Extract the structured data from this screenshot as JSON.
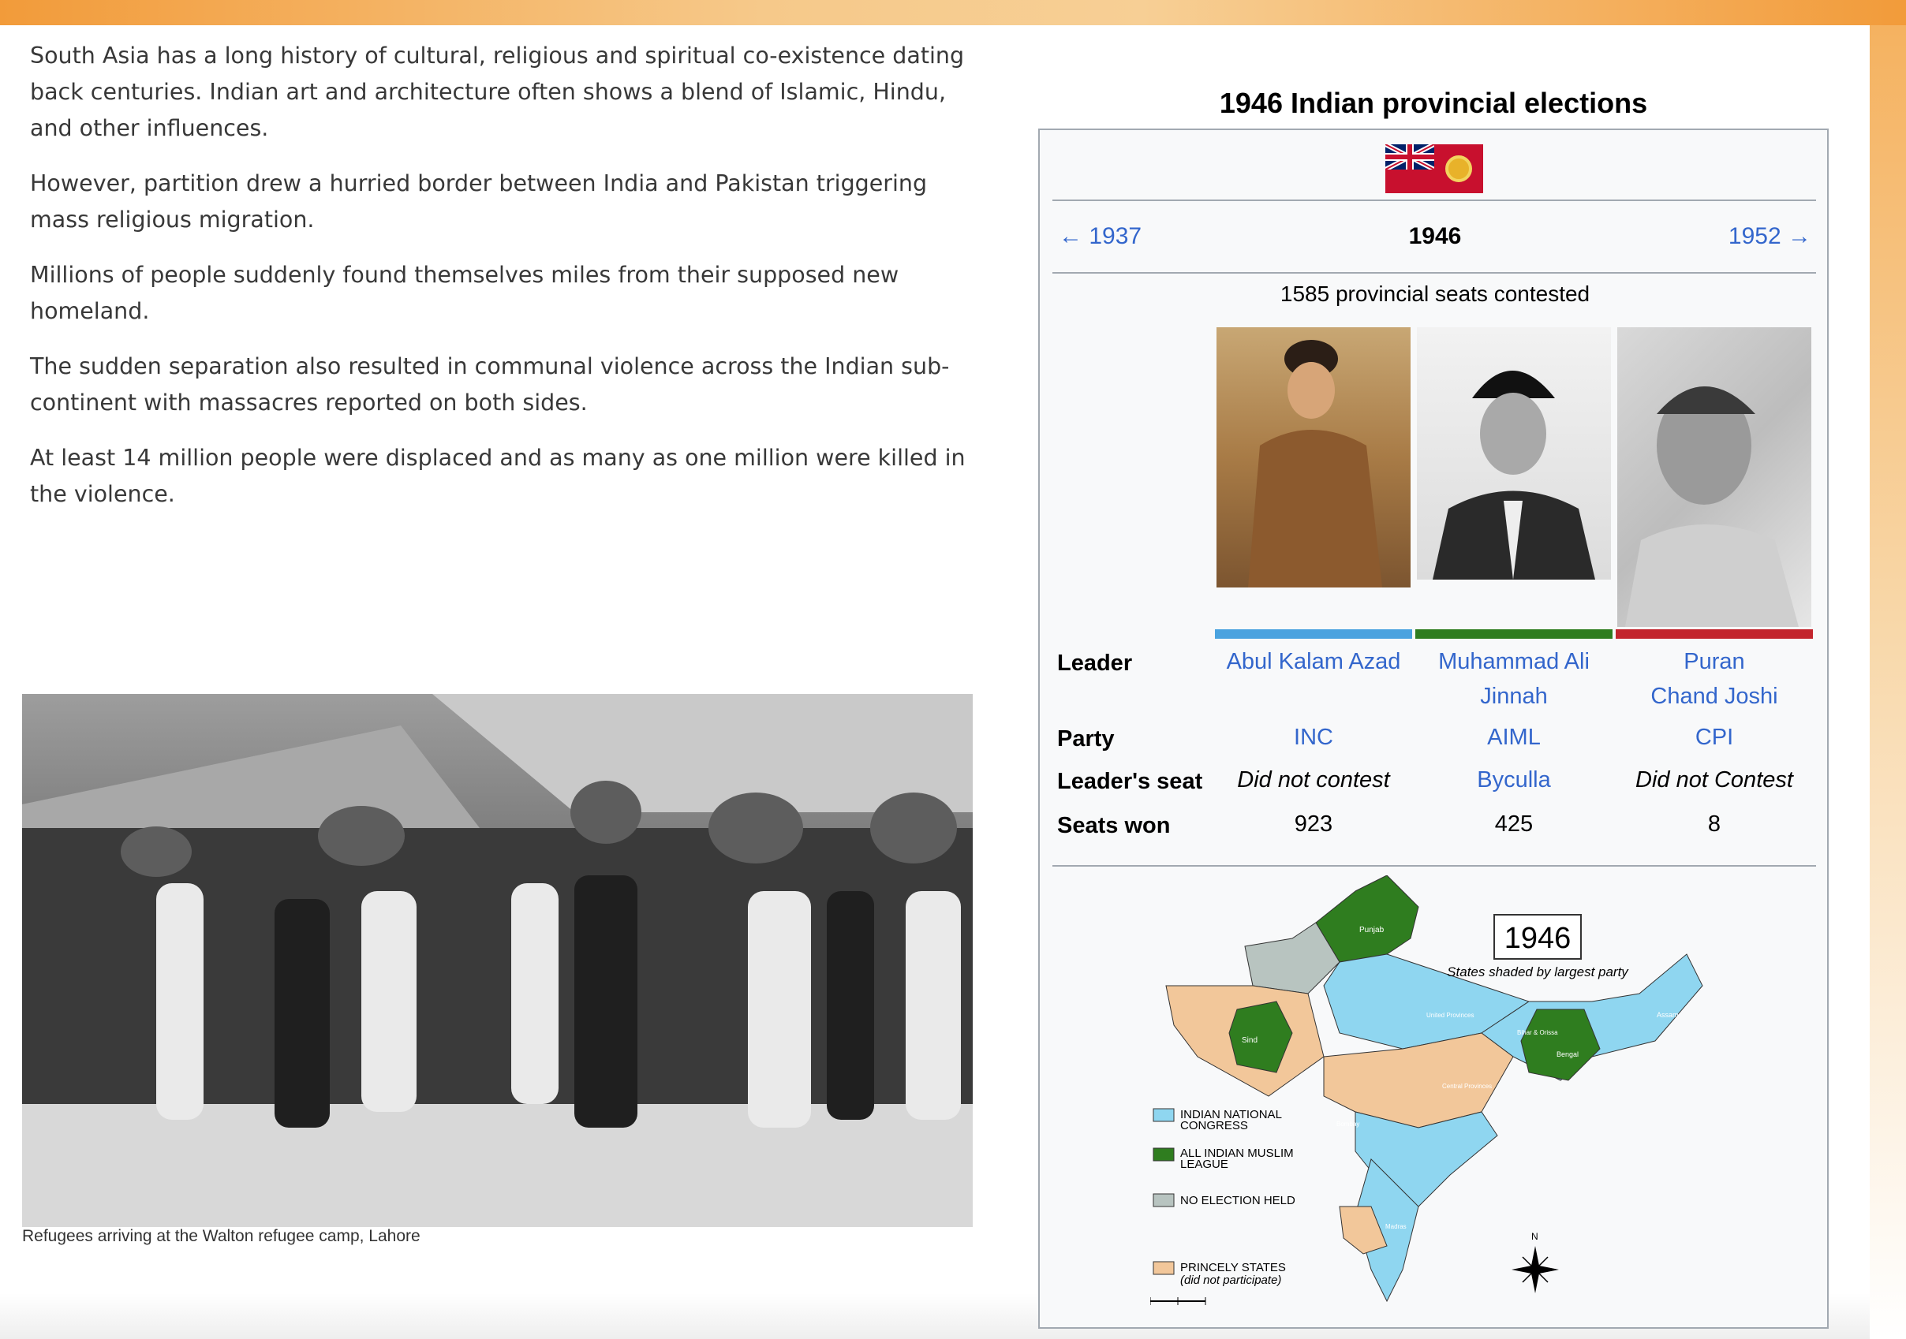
{
  "article": {
    "paragraphs": [
      "South Asia has a long history of cultural, religious and spiritual co-existence dating back centuries. Indian art and architecture often shows a blend of Islamic, Hindu, and other influences.",
      "However, partition drew a hurried border between India and Pakistan triggering mass religious migration.",
      "Millions of people suddenly found themselves miles from their supposed new homeland.",
      "The sudden separation also resulted in communal violence across the Indian sub-continent with massacres reported on both sides.",
      "At least 14 million people were displaced and as many as one million were killed in the violence."
    ],
    "photo_caption": "Refugees arriving at the Walton refugee camp, Lahore"
  },
  "infobox": {
    "title": "1946 Indian provincial elections",
    "prev": "← 1937",
    "current": "1946",
    "next": "1952 →",
    "seats_contested": "1585 provincial seats contested",
    "labels": {
      "leader": "Leader",
      "party": "Party",
      "seat": "Leader's seat",
      "won": "Seats won"
    },
    "candidates": [
      {
        "leader": "Abul Kalam Azad",
        "party": "INC",
        "seat": "Did not contest",
        "won": "923",
        "color": "#4aa3df"
      },
      {
        "leader": "Muhammad Ali Jinnah",
        "party": "AIML",
        "seat": "Byculla",
        "won": "425",
        "color": "#2f7d1f"
      },
      {
        "leader": "Puran Chand Joshi",
        "party": "CPI",
        "seat": "Did not Contest",
        "won": "8",
        "color": "#c3252d"
      }
    ],
    "map": {
      "year": "1946",
      "subtitle": "States shaded by largest party",
      "legend": [
        {
          "label1": "INDIAN NATIONAL",
          "label2": "CONGRESS",
          "color": "#8fd6f0"
        },
        {
          "label1": "ALL INDIAN MUSLIM",
          "label2": "LEAGUE",
          "color": "#2f7d1f"
        },
        {
          "label1": "NO ELECTION HELD",
          "label2": "",
          "color": "#b8c4c0"
        },
        {
          "label1": "PRINCELY STATES",
          "label2": "(did not participate)",
          "color": "#f2c79a"
        }
      ],
      "region_labels": [
        "Punjab",
        "Sind",
        "United Provinces",
        "Assam",
        "Bihar & Orissa",
        "Bengal",
        "Central Provinces",
        "Bombay",
        "Madras"
      ],
      "compass": "N"
    }
  }
}
